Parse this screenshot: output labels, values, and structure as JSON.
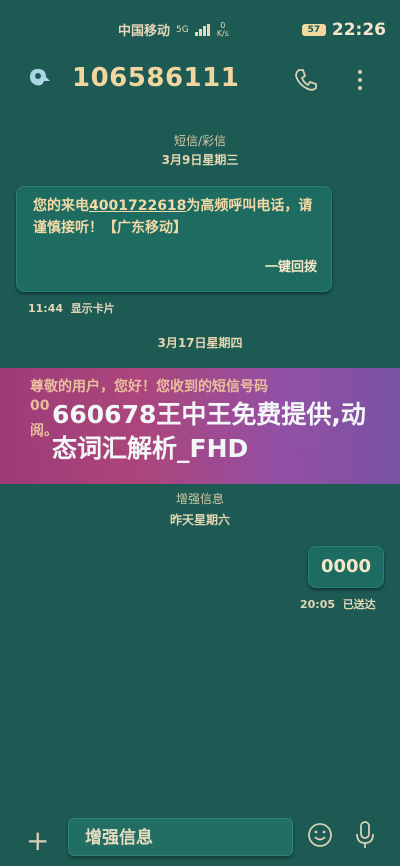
{
  "status_bar": {
    "carrier": "中国移动",
    "network": "5G",
    "speed_value": "0",
    "speed_unit": "K/s",
    "battery": "57",
    "time": "22:26"
  },
  "header": {
    "title": "106586111"
  },
  "thread": {
    "date1_type": "短信/彩信",
    "date1": "3月9日星期三",
    "msg1_text_a": "您的来电",
    "msg1_number": "4001722618",
    "msg1_text_b": "为高频呼叫电话，请谨慎接听！【广东移动】",
    "msg1_action": "一键回拨",
    "msg1_time": "11:44",
    "msg1_tag": "显示卡片",
    "date2": "3月17日星期四",
    "msg2_line1": "尊敬的用户，您好！您收到的短信号码",
    "msg2_line2": "00",
    "msg2_line3": "阅。",
    "date3_type": "增强信息",
    "date3": "昨天星期六",
    "sent_text": "0000",
    "sent_time": "20:05",
    "sent_status": "已送达"
  },
  "overlay_banner": {
    "headline": "660678王中王免费提供,动态词汇解析_FHD"
  },
  "composer": {
    "placeholder": "增强信息"
  },
  "colors": {
    "background": "#1c5a53",
    "bubble": "#1e6b62",
    "text": "#f2d9a6",
    "banner": "#a53a7a"
  }
}
